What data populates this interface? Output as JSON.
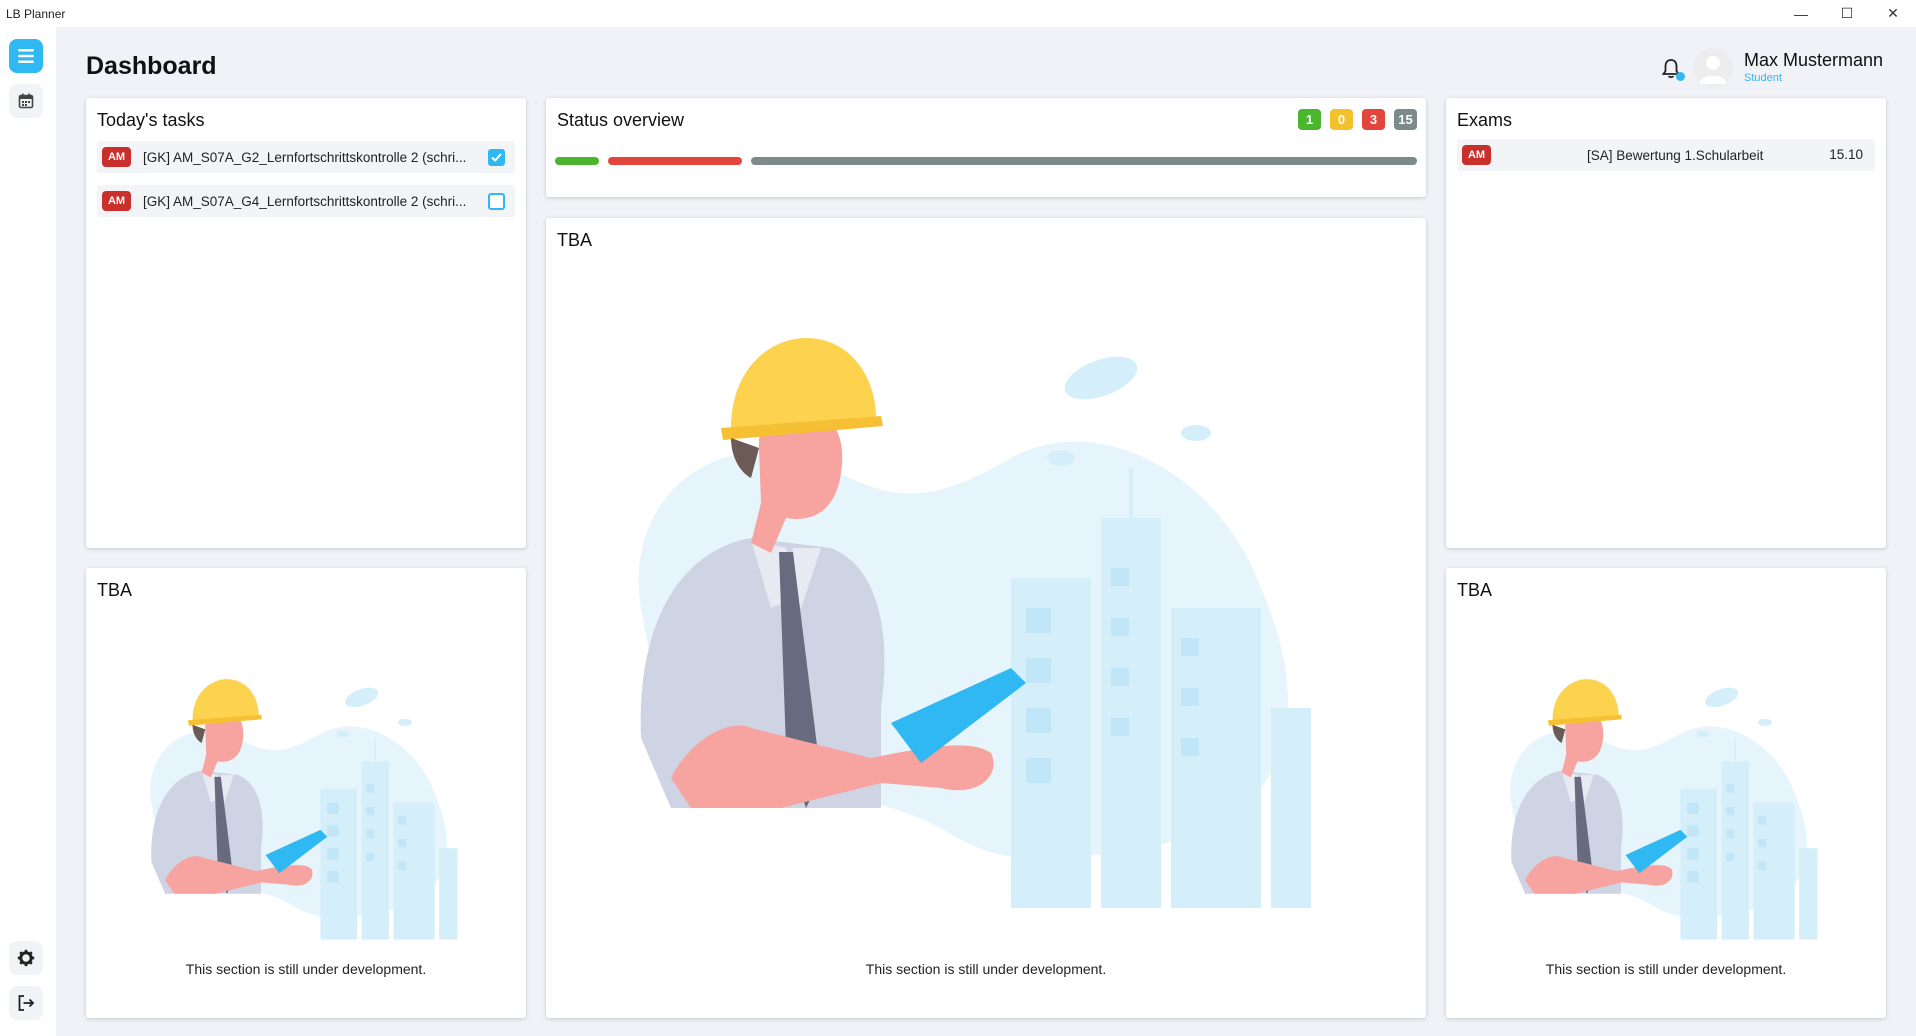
{
  "window": {
    "title": "LB Planner",
    "minimize": "—",
    "maximize": "☐",
    "close": "✕"
  },
  "sidebar": {
    "top_items": [
      {
        "icon": "menu-icon",
        "active": true
      },
      {
        "icon": "calendar-icon",
        "active": false
      }
    ],
    "bottom_items": [
      {
        "icon": "gear-icon"
      },
      {
        "icon": "logout-icon"
      }
    ]
  },
  "header": {
    "title": "Dashboard",
    "user": {
      "name": "Max Mustermann",
      "role": "Student"
    }
  },
  "todays_tasks": {
    "title": "Today's tasks",
    "items": [
      {
        "course": "AM",
        "text": "[GK] AM_S07A_G2_Lernfortschrittskontrolle 2 (schri...",
        "done": true
      },
      {
        "course": "AM",
        "text": "[GK] AM_S07A_G4_Lernfortschrittskontrolle 2 (schri...",
        "done": false
      }
    ]
  },
  "status_overview": {
    "title": "Status overview",
    "counts": {
      "done": "1",
      "pending": "0",
      "late": "3",
      "open": "15"
    },
    "colors": {
      "done": "#4ab52d",
      "pending": "#f2c12e",
      "late": "#e2453c",
      "open": "#7d8a8a"
    }
  },
  "exams": {
    "title": "Exams",
    "items": [
      {
        "course": "AM",
        "text": "[SA] Bewertung 1.Schularbeit",
        "date": "15.10"
      }
    ]
  },
  "tba": {
    "title": "TBA",
    "message": "This section is still under development."
  },
  "colors": {
    "accent": "#2fb8f1",
    "course_tag": "#c9302c",
    "background": "#f0f2f7"
  }
}
